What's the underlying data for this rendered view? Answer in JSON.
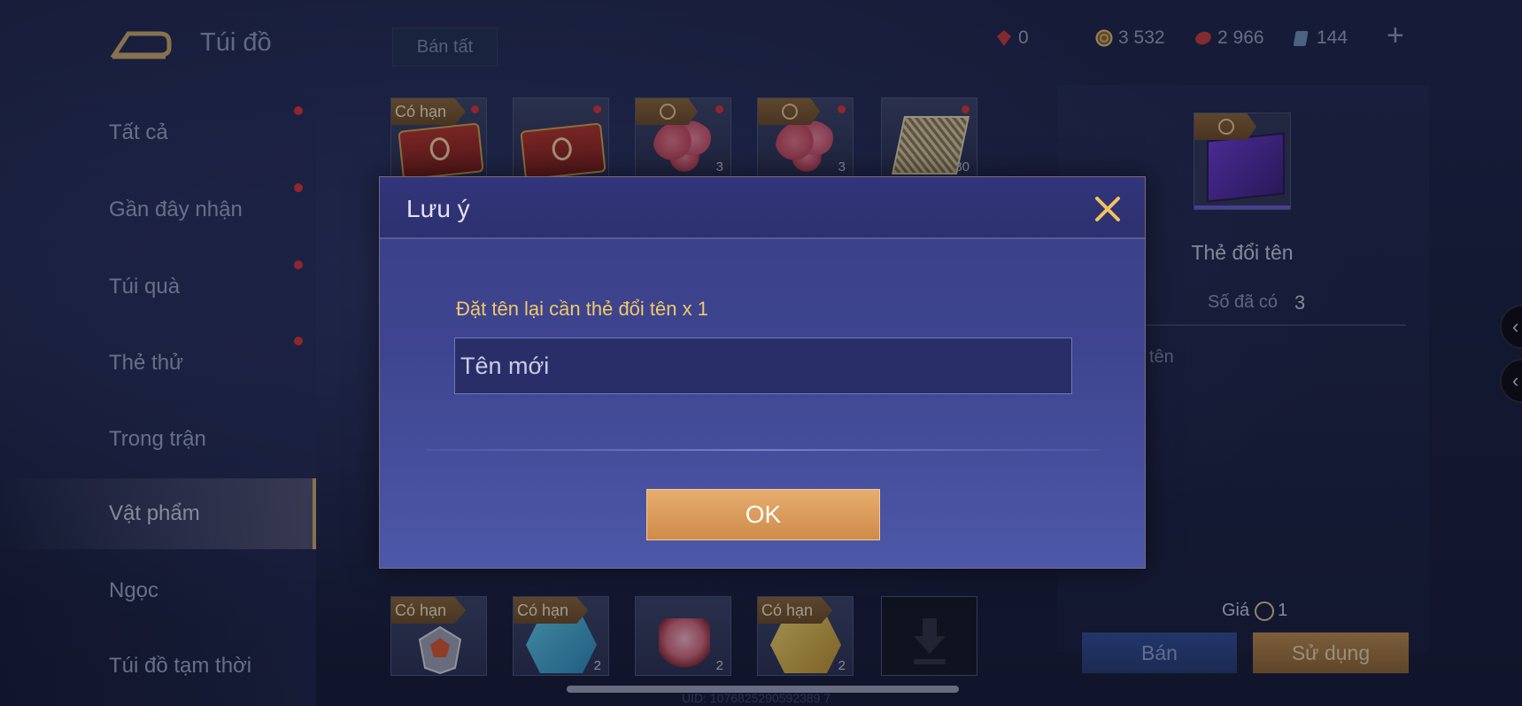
{
  "header": {
    "title": "Túi đồ",
    "sell_all": "Bán tất"
  },
  "currencies": [
    {
      "icon": "red-gem-icon",
      "value": "0"
    },
    {
      "icon": "gold-coin-icon",
      "value": "3 532"
    },
    {
      "icon": "voucher-icon",
      "value": "2 966"
    },
    {
      "icon": "card-icon",
      "value": "144"
    }
  ],
  "sidebar": {
    "items": [
      {
        "label": "Tất cả",
        "dot": true
      },
      {
        "label": "Gần đây nhận",
        "dot": true
      },
      {
        "label": "Túi quà",
        "dot": true
      },
      {
        "label": "Thẻ thử",
        "dot": true
      },
      {
        "label": "Trong trận",
        "dot": false
      },
      {
        "label": "Vật phẩm",
        "dot": false,
        "active": true
      },
      {
        "label": "Ngọc",
        "dot": false
      },
      {
        "label": "Túi đồ tạm thời",
        "dot": false
      }
    ]
  },
  "grid": {
    "badge_limited": "Có hạn",
    "top_counts": [
      "3",
      "3",
      "30"
    ],
    "bottom_counts": [
      "2",
      "2",
      "2"
    ]
  },
  "detail": {
    "name": "Thẻ đổi tên",
    "owned_label": "Số đã có",
    "owned_value": "3",
    "desc_fragment": "tên",
    "price_label": "Giá",
    "price_value": "1",
    "sell_button": "Bán",
    "use_button": "Sử dụng"
  },
  "footer": {
    "uid": "UID: 1076825290592389 7"
  },
  "dialog": {
    "title": "Lưu ý",
    "prompt": "Đặt tên lại cần thẻ đổi tên x 1",
    "input_placeholder": "Tên mới",
    "ok_button": "OK"
  },
  "colors": {
    "accent_gold": "#f0c86b",
    "ok_button": "#e6ad6e",
    "notification_dot": "#d8333a"
  }
}
